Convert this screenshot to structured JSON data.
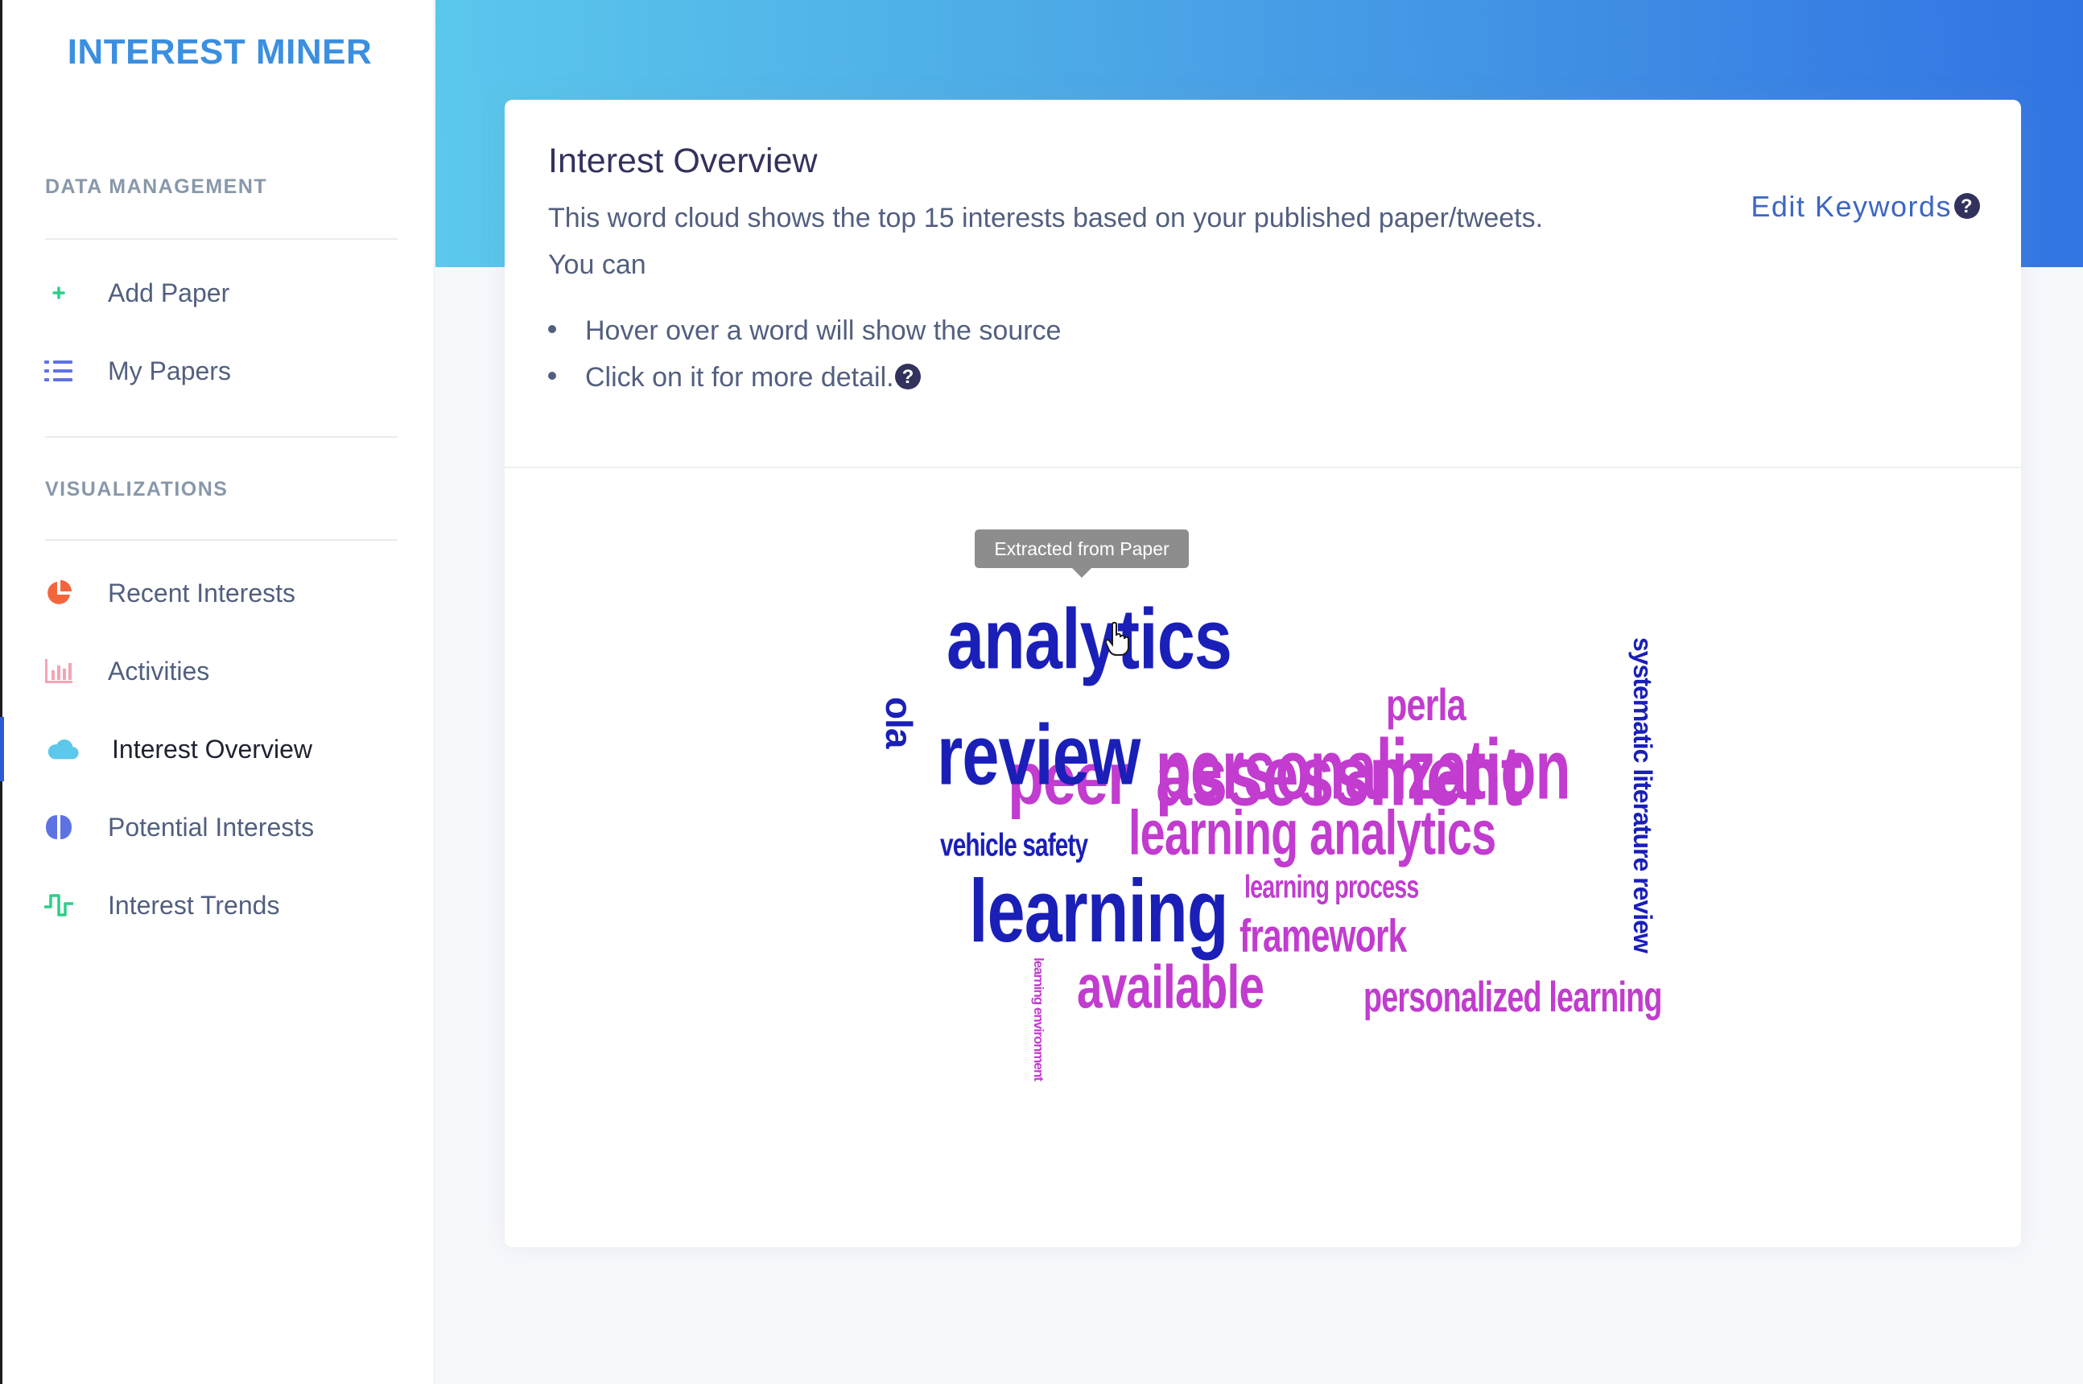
{
  "brand": "INTEREST MINER",
  "sidebar": {
    "data_heading": "DATA MANAGEMENT",
    "data_items": [
      {
        "label": "Add Paper",
        "icon": "plus-icon"
      },
      {
        "label": "My Papers",
        "icon": "list-icon"
      }
    ],
    "vis_heading": "VISUALIZATIONS",
    "vis_items": [
      {
        "label": "Recent Interests",
        "icon": "pie-chart-icon"
      },
      {
        "label": "Activities",
        "icon": "bar-chart-icon"
      },
      {
        "label": "Interest Overview",
        "icon": "cloud-icon",
        "active": true
      },
      {
        "label": "Potential Interests",
        "icon": "brain-icon"
      },
      {
        "label": "Interest Trends",
        "icon": "pulse-icon"
      }
    ]
  },
  "card": {
    "title": "Interest Overview",
    "description": "This word cloud shows the top 15 interests based on your published paper/tweets.",
    "description_2": "You can",
    "bullets": [
      "Hover over a word will show the source",
      "Click on it for more detail."
    ],
    "edit_keywords": "Edit Keywords"
  },
  "tooltip": "Extracted from Paper",
  "colors": {
    "paper_words": "#1a1fb8",
    "tweet_words": "#c13ccf",
    "brand": "#3b8fe0"
  },
  "words": [
    {
      "text": "analytics",
      "color": "paper"
    },
    {
      "text": "ola",
      "color": "paper"
    },
    {
      "text": "review",
      "color": "paper"
    },
    {
      "text": "peer",
      "color": "tweet"
    },
    {
      "text": "assessment",
      "color": "tweet"
    },
    {
      "text": "personalization",
      "color": "tweet"
    },
    {
      "text": "perla",
      "color": "tweet"
    },
    {
      "text": "systematic literature review",
      "color": "paper"
    },
    {
      "text": "vehicle safety",
      "color": "paper"
    },
    {
      "text": "learning analytics",
      "color": "tweet"
    },
    {
      "text": "learning",
      "color": "paper"
    },
    {
      "text": "learning process",
      "color": "tweet"
    },
    {
      "text": "framework",
      "color": "tweet"
    },
    {
      "text": "available",
      "color": "tweet"
    },
    {
      "text": "personalized learning",
      "color": "tweet"
    },
    {
      "text": "learning environment",
      "color": "tweet"
    }
  ]
}
